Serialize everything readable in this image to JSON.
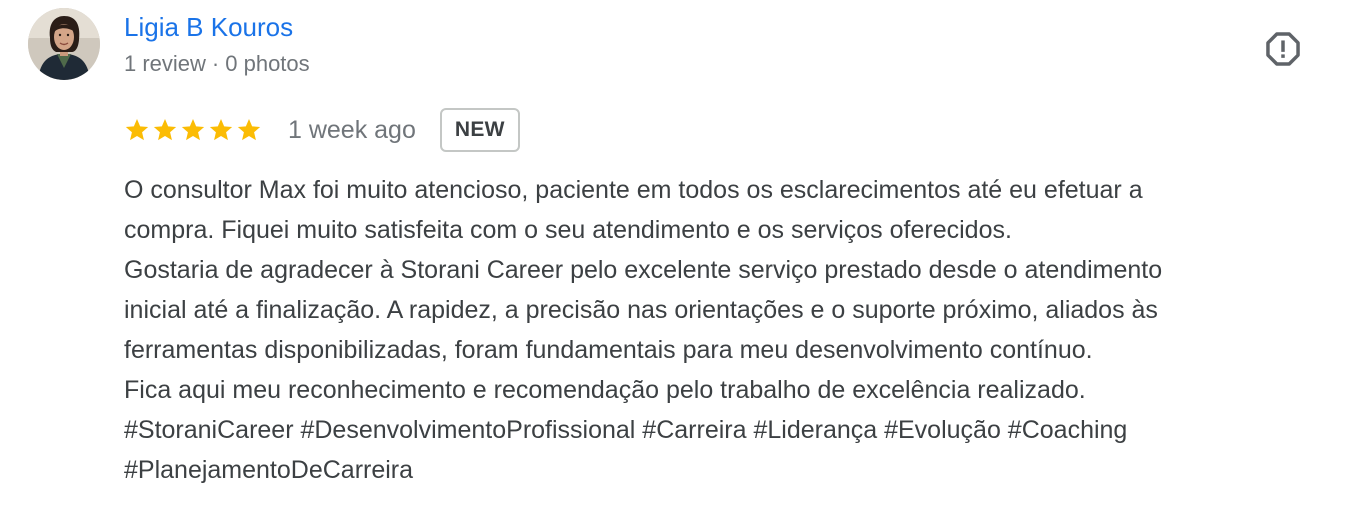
{
  "reviewer": {
    "name": "Ligia B Kouros",
    "review_count": "1 review",
    "separator": "·",
    "photo_count": "0 photos",
    "avatar_icon": "user-avatar-photo"
  },
  "flag": {
    "icon": "report-flag-icon"
  },
  "rating": {
    "stars": 5,
    "max_stars": 5,
    "star_color": "#fbbc04",
    "time_ago": "1 week ago",
    "badge": "NEW"
  },
  "review_text": {
    "lines": [
      "O consultor Max foi muito atencioso, paciente em todos os esclarecimentos até eu efetuar a",
      "compra. Fiquei muito satisfeita com o seu atendimento e os serviços oferecidos.",
      "Gostaria de agradecer à Storani Career pelo excelente serviço prestado desde o atendimento",
      "inicial até a finalização. A rapidez, a precisão nas orientações e o suporte próximo, aliados às",
      "ferramentas disponibilizadas, foram fundamentais para meu desenvolvimento contínuo.",
      "Fica aqui meu reconhecimento e recomendação pelo trabalho de excelência realizado.",
      "#StoraniCareer #DesenvolvimentoProfissional #Carreira #Liderança #Evolução #Coaching",
      "#PlanejamentoDeCarreira"
    ]
  },
  "colors": {
    "name_link": "#1a73e8",
    "meta_text": "#70757a",
    "body_text": "#3c4043"
  }
}
